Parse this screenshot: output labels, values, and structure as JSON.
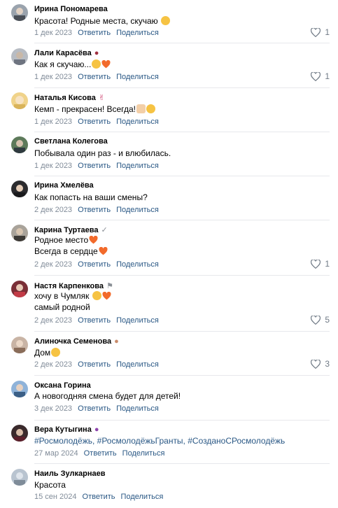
{
  "actions": {
    "reply": "Ответить",
    "share": "Поделиться"
  },
  "colors": {
    "link": "#2a5885",
    "meta": "#818c99",
    "emoji_yellow": "#f6c343",
    "heart": "#f26a2b"
  },
  "comments": [
    {
      "author": "Ирина Пономарева",
      "badge": "",
      "lines": [
        "Красота! Родные места, скучаю"
      ],
      "date": "1 дек 2023",
      "likes": "1"
    },
    {
      "author": "Лали Карасёва",
      "badge": "",
      "lines": [
        "Как я скучаю..."
      ],
      "date": "1 дек 2023",
      "likes": "1"
    },
    {
      "author": "Наталья Кисова",
      "badge": "",
      "lines": [
        "Кемп - прекрасен! Всегда!"
      ],
      "date": "1 дек 2023",
      "likes": ""
    },
    {
      "author": "Светлана Колегова",
      "badge": "",
      "lines": [
        "Побывала один раз - и влюбилась."
      ],
      "date": "1 дек 2023",
      "likes": ""
    },
    {
      "author": "Ирина Хмелёва",
      "badge": "",
      "lines": [
        "Как попасть на ваши смены?"
      ],
      "date": "2 дек 2023",
      "likes": ""
    },
    {
      "author": "Карина Туртаева",
      "badge": "✓",
      "lines": [
        "Родное место",
        "Всегда в сердце"
      ],
      "date": "2 дек 2023",
      "likes": "1"
    },
    {
      "author": "Настя Карпенкова",
      "badge": "",
      "lines": [
        "хочу в Чумляк",
        "самый родной"
      ],
      "date": "2 дек 2023",
      "likes": "5"
    },
    {
      "author": "Алиночка Семенова",
      "badge": "",
      "lines": [
        "Дом"
      ],
      "date": "2 дек 2023",
      "likes": "3"
    },
    {
      "author": "Оксана Горина",
      "badge": "",
      "lines": [
        "А новогодняя смена будет для детей!"
      ],
      "date": "3 дек 2023",
      "likes": ""
    },
    {
      "author": "Вера Кутыгина",
      "badge": "",
      "lines": [
        "#Росмолодёжь, #РосмолодёжьГранты, #СозданоСРосмолодёжь"
      ],
      "date": "27 мар 2024",
      "likes": ""
    },
    {
      "author": "Наиль Зулкарнаев",
      "badge": "",
      "lines": [
        "Красота"
      ],
      "date": "15 сен 2024",
      "likes": ""
    }
  ]
}
